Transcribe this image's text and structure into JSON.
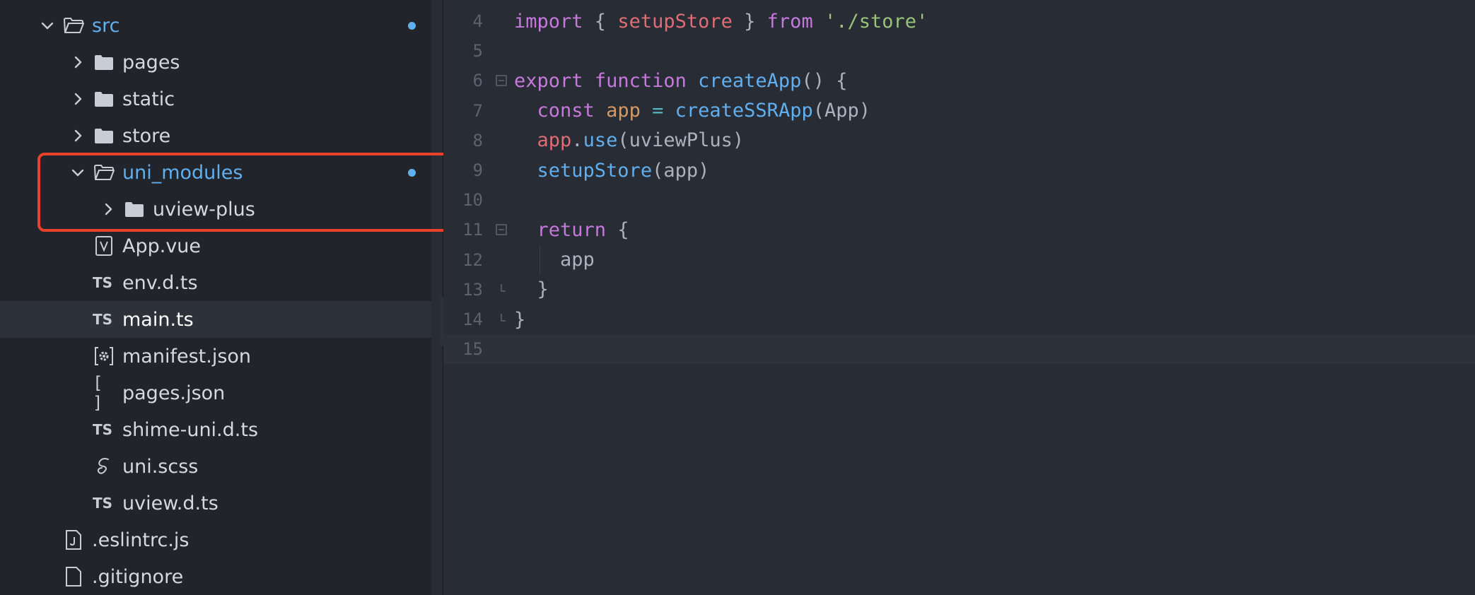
{
  "explorer": {
    "items": [
      {
        "label": "src",
        "depth": 0,
        "type": "folder",
        "expanded": true,
        "modified": true
      },
      {
        "label": "pages",
        "depth": 1,
        "type": "folder",
        "expanded": false
      },
      {
        "label": "static",
        "depth": 1,
        "type": "folder",
        "expanded": false
      },
      {
        "label": "store",
        "depth": 1,
        "type": "folder",
        "expanded": false
      },
      {
        "label": "uni_modules",
        "depth": 1,
        "type": "folder",
        "expanded": true,
        "modified": true
      },
      {
        "label": "uview-plus",
        "depth": 2,
        "type": "folder",
        "expanded": false
      },
      {
        "label": "App.vue",
        "depth": 1,
        "type": "vue"
      },
      {
        "label": "env.d.ts",
        "depth": 1,
        "type": "ts",
        "badge": "TS"
      },
      {
        "label": "main.ts",
        "depth": 1,
        "type": "ts",
        "badge": "TS",
        "active": true
      },
      {
        "label": "manifest.json",
        "depth": 1,
        "type": "manifest"
      },
      {
        "label": "pages.json",
        "depth": 1,
        "type": "json",
        "badge": "[ ]"
      },
      {
        "label": "shime-uni.d.ts",
        "depth": 1,
        "type": "ts",
        "badge": "TS"
      },
      {
        "label": "uni.scss",
        "depth": 1,
        "type": "scss"
      },
      {
        "label": "uview.d.ts",
        "depth": 1,
        "type": "ts",
        "badge": "TS"
      },
      {
        "label": ".eslintrc.js",
        "depth": 0,
        "type": "js"
      },
      {
        "label": ".gitignore",
        "depth": 0,
        "type": "file"
      }
    ]
  },
  "editor": {
    "lines": [
      {
        "num": "4",
        "tokens": [
          [
            "kw",
            "import"
          ],
          [
            "p",
            " { "
          ],
          [
            "var",
            "setupStore"
          ],
          [
            "p",
            " } "
          ],
          [
            "kw",
            "from"
          ],
          [
            "p",
            " "
          ],
          [
            "str",
            "'./store'"
          ]
        ]
      },
      {
        "num": "5",
        "tokens": []
      },
      {
        "num": "6",
        "fold": "open",
        "tokens": [
          [
            "kw",
            "export"
          ],
          [
            "p",
            " "
          ],
          [
            "kw",
            "function"
          ],
          [
            "p",
            " "
          ],
          [
            "fn",
            "createApp"
          ],
          [
            "p",
            "() {"
          ]
        ]
      },
      {
        "num": "7",
        "tokens": [
          [
            "p",
            "  "
          ],
          [
            "kw",
            "const"
          ],
          [
            "p",
            " "
          ],
          [
            "const",
            "app"
          ],
          [
            "p",
            " "
          ],
          [
            "op",
            "="
          ],
          [
            "p",
            " "
          ],
          [
            "fn",
            "createSSRApp"
          ],
          [
            "p",
            "(App)"
          ]
        ]
      },
      {
        "num": "8",
        "tokens": [
          [
            "p",
            "  "
          ],
          [
            "var",
            "app"
          ],
          [
            "p",
            "."
          ],
          [
            "fn",
            "use"
          ],
          [
            "p",
            "(uviewPlus)"
          ]
        ]
      },
      {
        "num": "9",
        "tokens": [
          [
            "p",
            "  "
          ],
          [
            "fn",
            "setupStore"
          ],
          [
            "p",
            "(app)"
          ]
        ]
      },
      {
        "num": "10",
        "tokens": []
      },
      {
        "num": "11",
        "fold": "open",
        "tokens": [
          [
            "p",
            "  "
          ],
          [
            "kw",
            "return"
          ],
          [
            "p",
            " {"
          ]
        ]
      },
      {
        "num": "12",
        "tokens": [
          [
            "p",
            "    app"
          ]
        ]
      },
      {
        "num": "13",
        "fold": "end",
        "tokens": [
          [
            "p",
            "  }"
          ]
        ]
      },
      {
        "num": "14",
        "fold": "end",
        "tokens": [
          [
            "p",
            "}"
          ]
        ]
      },
      {
        "num": "15",
        "current": true,
        "tokens": []
      }
    ]
  },
  "colors": {
    "accent": "#61afef",
    "highlight_box": "#e8422b"
  }
}
